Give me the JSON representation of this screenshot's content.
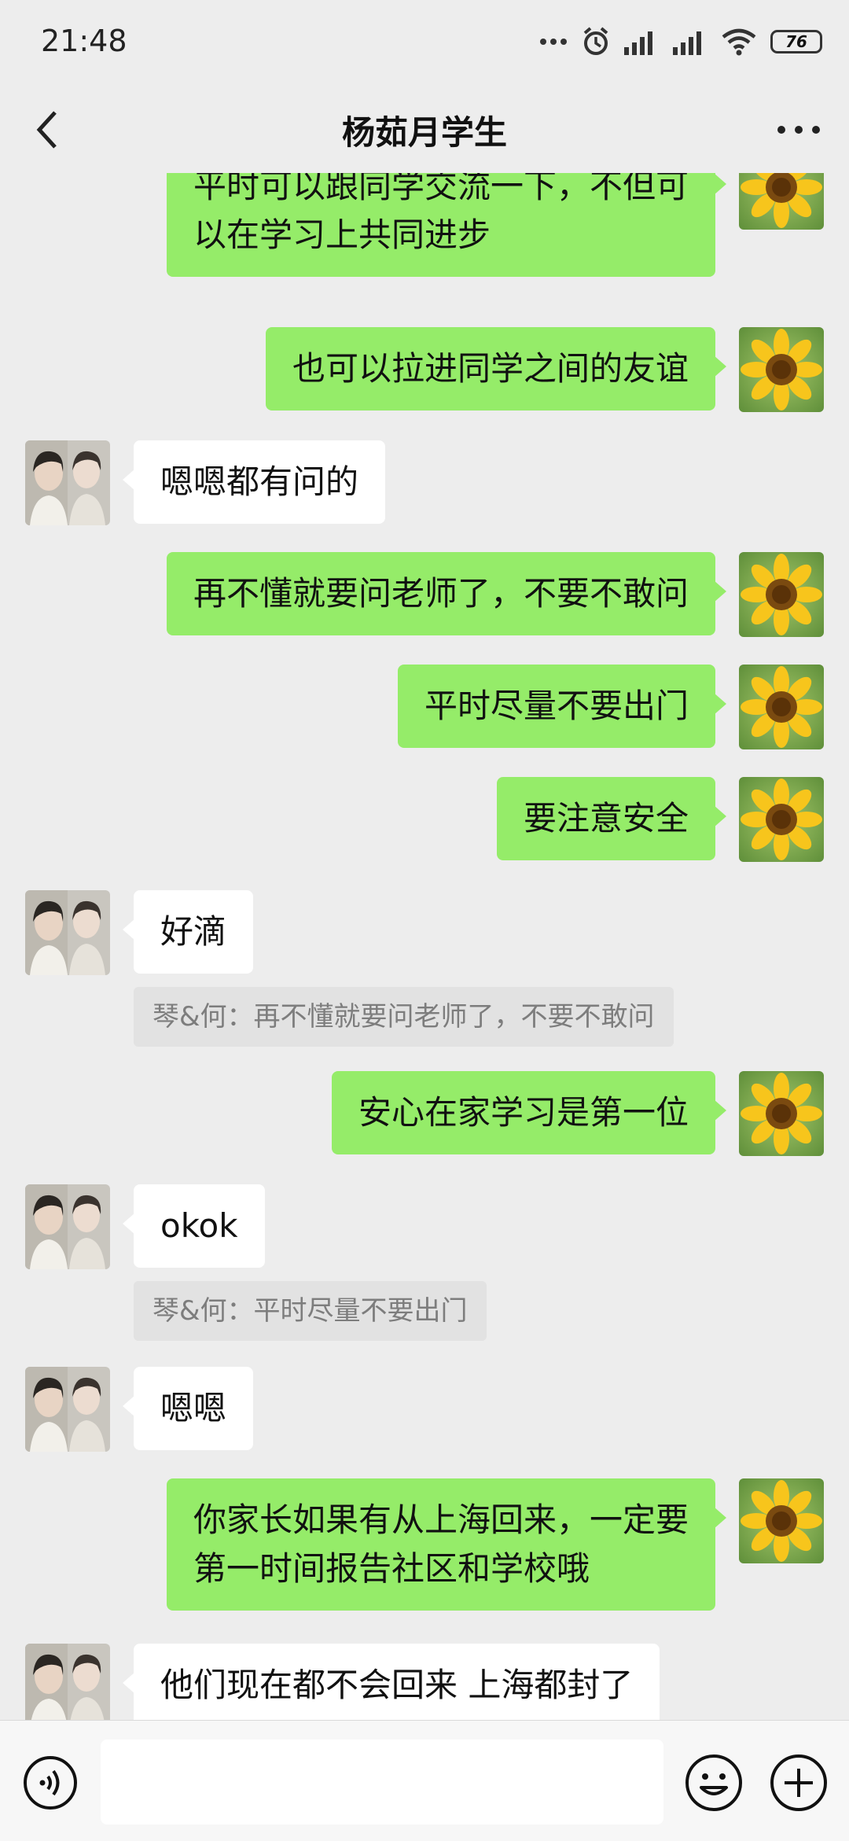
{
  "status_bar": {
    "time": "21:48",
    "battery": "76"
  },
  "header": {
    "title": "杨茹月学生"
  },
  "messages": [
    {
      "sender": "me",
      "lines": [
        "平时可以跟同学交流一下，不但可",
        "以在学习上共同进步"
      ]
    },
    {
      "sender": "me",
      "lines": [
        "也可以拉进同学之间的友谊"
      ]
    },
    {
      "sender": "them",
      "lines": [
        "嗯嗯都有问的"
      ]
    },
    {
      "sender": "me",
      "lines": [
        "再不懂就要问老师了，不要不敢问"
      ]
    },
    {
      "sender": "me",
      "lines": [
        "平时尽量不要出门"
      ]
    },
    {
      "sender": "me",
      "lines": [
        "要注意安全"
      ]
    },
    {
      "sender": "them",
      "lines": [
        "好滴"
      ],
      "quote": "琴&何：再不懂就要问老师了，不要不敢问"
    },
    {
      "sender": "me",
      "lines": [
        "安心在家学习是第一位"
      ]
    },
    {
      "sender": "them",
      "lines": [
        "okok"
      ],
      "quote": "琴&何：平时尽量不要出门"
    },
    {
      "sender": "them",
      "lines": [
        "嗯嗯"
      ]
    },
    {
      "sender": "me",
      "lines": [
        "你家长如果有从上海回来，一定要",
        "第一时间报告社区和学校哦"
      ]
    },
    {
      "sender": "them",
      "lines": [
        "他们现在都不会回来 上海都封了"
      ]
    }
  ],
  "icons": {
    "back": "chevron-left-icon",
    "more": "more-dots-icon",
    "voice": "voice-icon",
    "emoji": "emoji-icon",
    "plus": "plus-icon",
    "my_avatar": "sunflower",
    "their_avatar": "two-people-photo"
  },
  "colors": {
    "background": "#ededed",
    "outgoing_bubble": "#95ec69",
    "incoming_bubble": "#ffffff",
    "quote_bg": "#e2e2e2"
  }
}
